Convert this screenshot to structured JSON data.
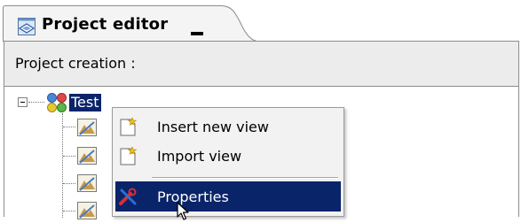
{
  "view_tab": {
    "title": "Project editor",
    "icon": "project-editor-icon"
  },
  "header": {
    "label": "Project creation :"
  },
  "tree": {
    "root": {
      "label": "Test",
      "icon": "colored-circles-icon",
      "expanded": true
    },
    "child_icon": "image-view-icon"
  },
  "context_menu": {
    "items": [
      {
        "label": "Insert new view",
        "icon": "new-file-icon"
      },
      {
        "label": "Import view",
        "icon": "new-file-icon"
      },
      {
        "label": "Properties",
        "icon": "wrench-icon",
        "selected": true
      }
    ]
  },
  "colors": {
    "selection": "#0a246a",
    "header_bg": "#ececec",
    "menu_bg": "#f2f2f2"
  }
}
